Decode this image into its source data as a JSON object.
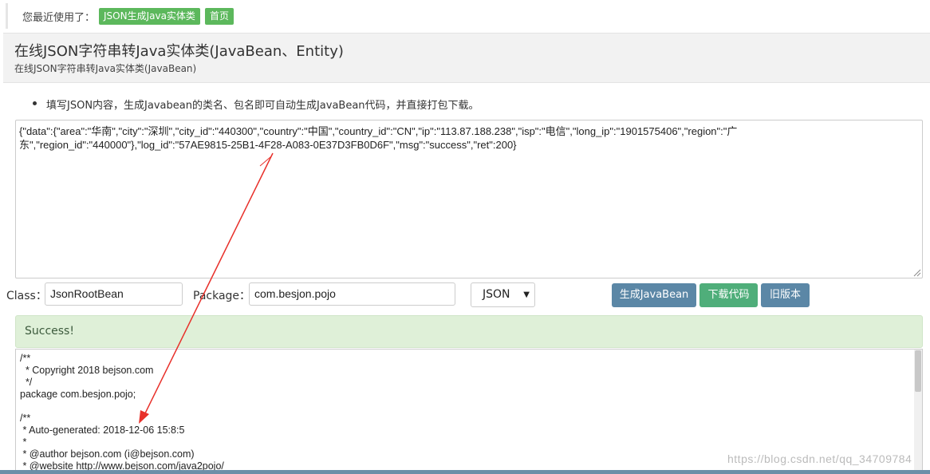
{
  "recent": {
    "label": "您最近使用了：",
    "tags": [
      "JSON生成Java实体类",
      "首页"
    ]
  },
  "header": {
    "title": "在线JSON字符串转Java实体类(JavaBean、Entity)",
    "subtitle": "在线JSON字符串转Java实体类(JavaBean)"
  },
  "tip": "填写JSON内容，生成Javabean的类名、包名即可自动生成JavaBean代码，并直接打包下载。",
  "json_input": "{\"data\":{\"area\":\"华南\",\"city\":\"深圳\",\"city_id\":\"440300\",\"country\":\"中国\",\"country_id\":\"CN\",\"ip\":\"113.87.188.238\",\"isp\":\"电信\",\"long_ip\":\"1901575406\",\"region\":\"广\n东\",\"region_id\":\"440000\"},\"log_id\":\"57AE9815-25B1-4F28-A083-0E37D3FB0D6F\",\"msg\":\"success\",\"ret\":200}",
  "form": {
    "class_label": "Class：",
    "class_value": "JsonRootBean",
    "package_label": "Package：",
    "package_value": "com.besjon.pojo",
    "format_value": "JSON"
  },
  "buttons": {
    "generate": "生成JavaBean",
    "download": "下载代码",
    "old_version": "旧版本"
  },
  "result": {
    "status": "Success!",
    "code": "/**\n  * Copyright 2018 bejson.com\n  */\npackage com.besjon.pojo;\n\n/**\n * Auto-generated: 2018-12-06 15:8:5\n *\n * @author bejson.com (i@bejson.com)\n * @website http://www.bejson.com/java2pojo/"
  },
  "watermark": "https://blog.csdn.net/qq_34709784",
  "colors": {
    "tag_green": "#5cb85c",
    "btn_blue": "#5b87a6",
    "btn_green": "#4fae7a",
    "success_bg": "#dff0d8",
    "annotation_arrow": "#e8302a"
  }
}
